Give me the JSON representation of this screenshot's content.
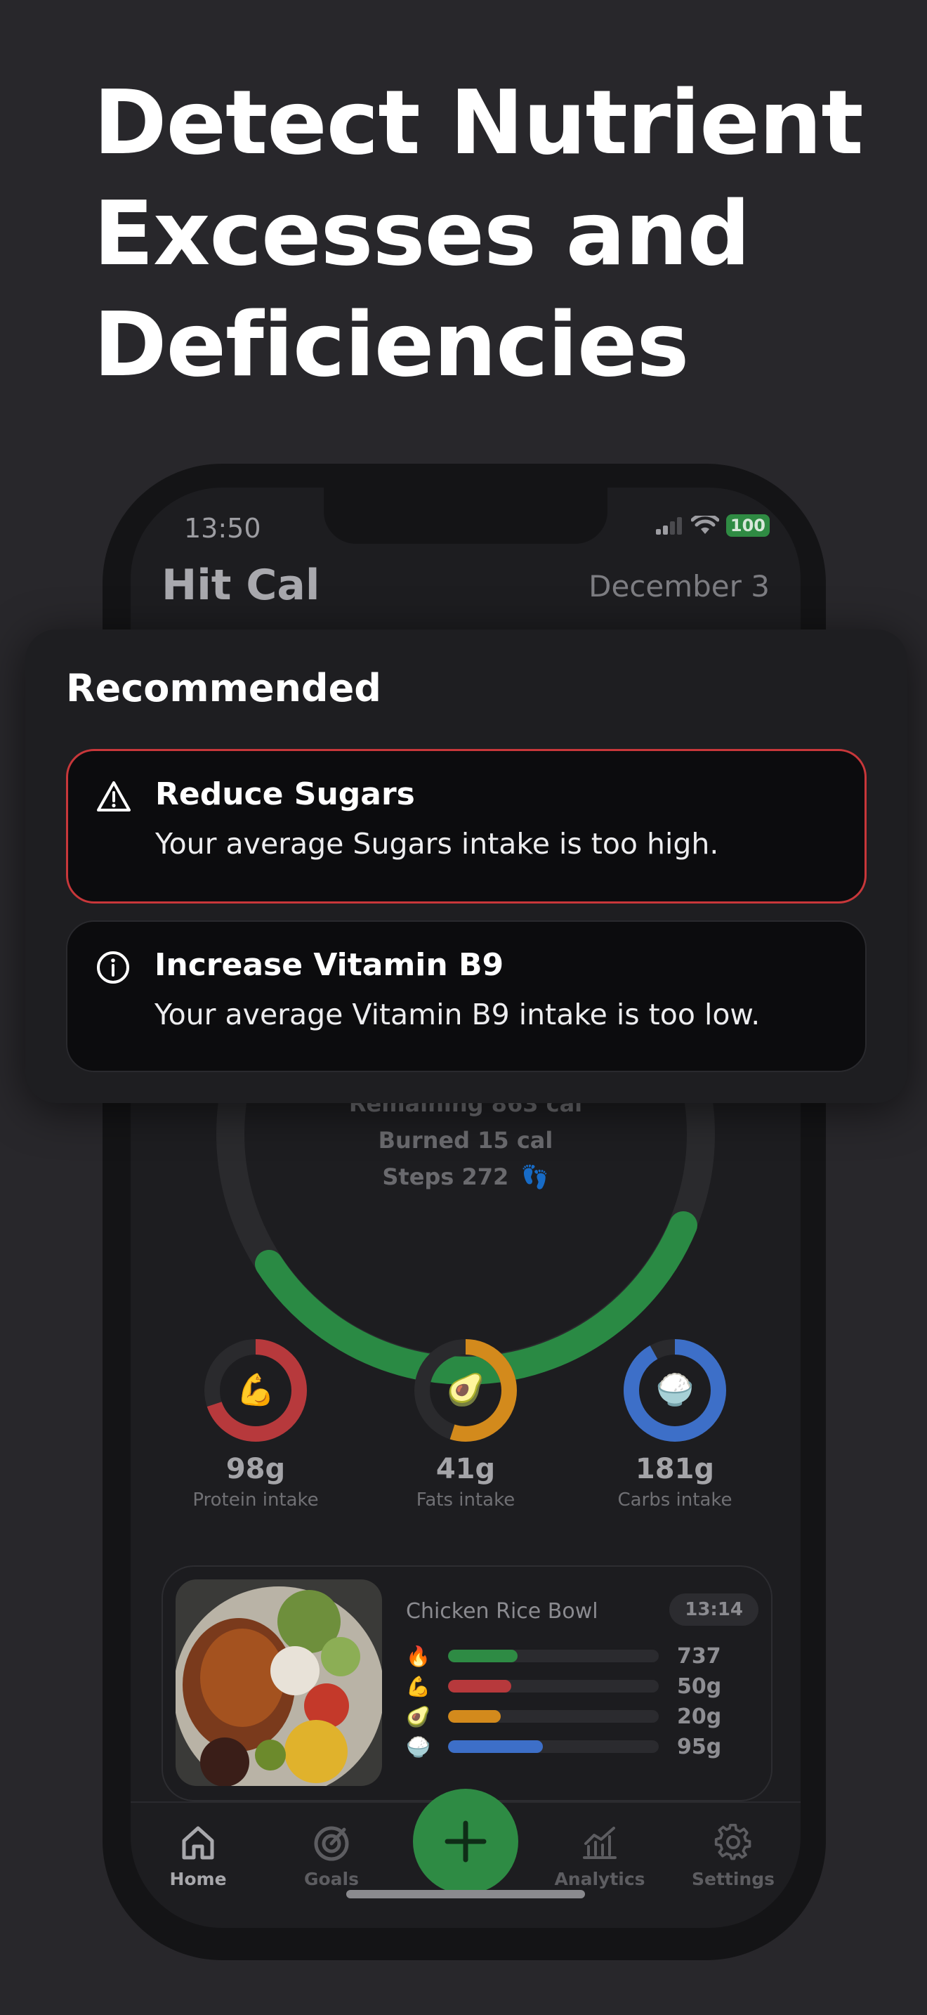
{
  "headline": [
    "Detect Nutrient",
    "Excesses and",
    "Deficiencies"
  ],
  "status": {
    "time": "13:50",
    "battery": "100"
  },
  "app": {
    "title": "Hit Cal",
    "date": "December 3"
  },
  "summary": {
    "remaining": "Remaining 863 cal",
    "burned": "Burned 15 cal",
    "steps": "Steps 272  👣"
  },
  "macros": [
    {
      "value": "98g",
      "label": "Protein intake",
      "emoji": "💪",
      "color": "#b7393c",
      "progress": 0.7
    },
    {
      "value": "41g",
      "label": "Fats intake",
      "emoji": "🥑",
      "color": "#d38a1c",
      "progress": 0.55
    },
    {
      "value": "181g",
      "label": "Carbs intake",
      "emoji": "🍚",
      "color": "#3d6fc8",
      "progress": 0.92
    }
  ],
  "meal": {
    "name": "Chicken Rice Bowl",
    "time": "13:14",
    "nutrients": [
      {
        "icon": "🔥",
        "amount": "737",
        "color": "#2e8b44",
        "progress": 0.33
      },
      {
        "icon": "💪",
        "amount": "50g",
        "color": "#b7393c",
        "progress": 0.3
      },
      {
        "icon": "🥑",
        "amount": "20g",
        "color": "#d38a1c",
        "progress": 0.25
      },
      {
        "icon": "🍚",
        "amount": "95g",
        "color": "#3d6fc8",
        "progress": 0.45
      }
    ]
  },
  "tabs": [
    {
      "label": "Home",
      "icon": "home-icon",
      "active": true
    },
    {
      "label": "Goals",
      "icon": "goals-icon",
      "active": false
    },
    {
      "label": "Analytics",
      "icon": "analytics-icon",
      "active": false
    },
    {
      "label": "Settings",
      "icon": "gear-icon",
      "active": false
    }
  ],
  "recommended": {
    "title": "Recommended",
    "items": [
      {
        "type": "warning",
        "title": "Reduce Sugars",
        "message": "Your average Sugars intake is too high.",
        "color": "#c8373a"
      },
      {
        "type": "info",
        "title": "Increase Vitamin B9",
        "message": "Your average Vitamin B9 intake is too low."
      }
    ]
  },
  "colors": {
    "accent": "#2e8b44",
    "background": "#28272b"
  }
}
